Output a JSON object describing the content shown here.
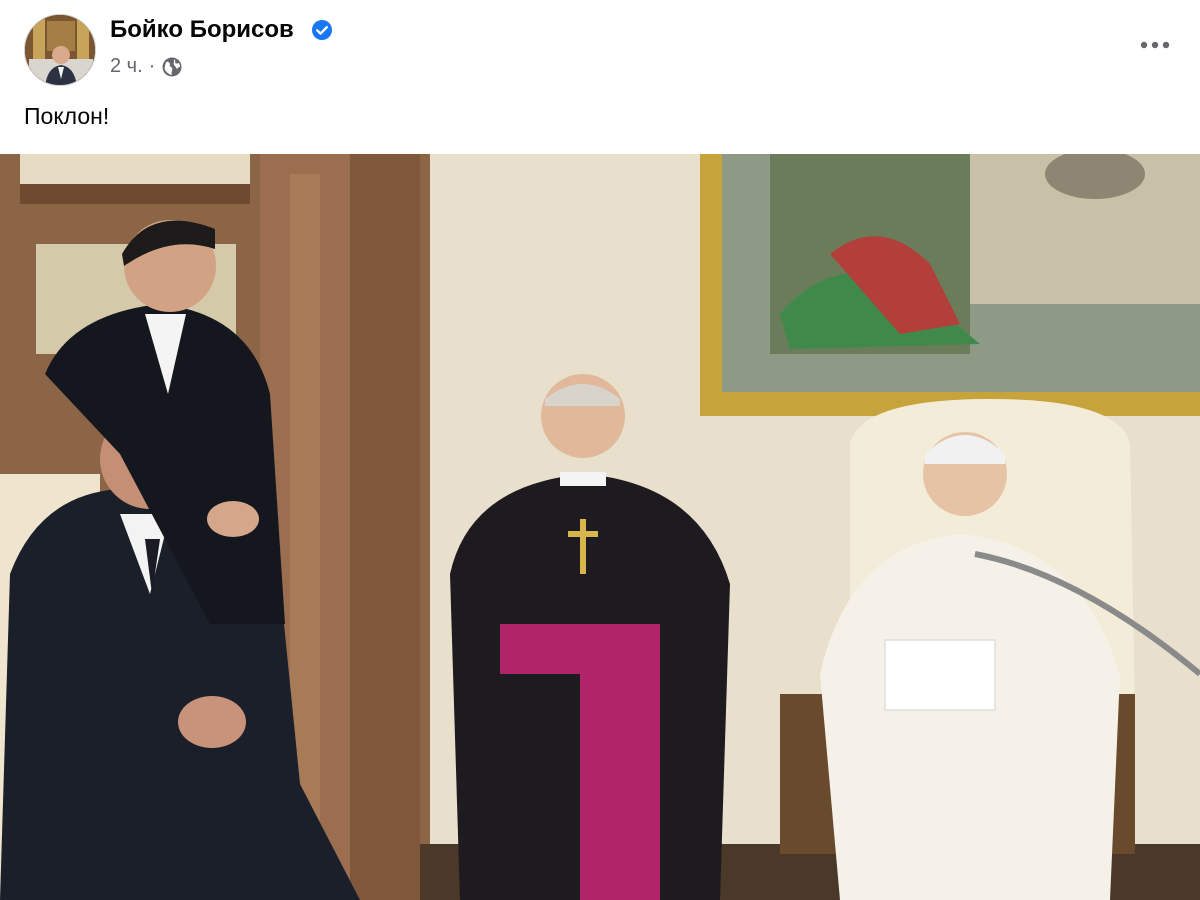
{
  "post": {
    "author_name": "Бойко Борисов",
    "verified": true,
    "time": "2 ч.",
    "separator": "·",
    "audience_icon": "globe-icon",
    "more_icon": "more-options-icon",
    "text": "Поклон!",
    "photo_icon": "post-photo"
  },
  "colors": {
    "verified_blue": "#1877f2",
    "meta_gray": "#65676b",
    "text_dark": "#050505"
  }
}
